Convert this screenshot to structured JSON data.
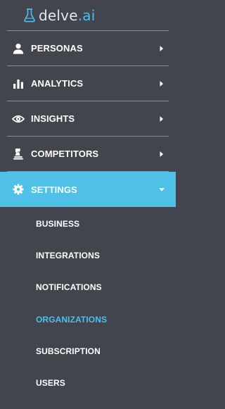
{
  "brand": {
    "name_main": "delve",
    "name_suffix": ".ai",
    "accent_color": "#4fc1e9"
  },
  "nav": {
    "items": [
      {
        "label": "PERSONAS",
        "icon": "user-icon",
        "state": "collapsed"
      },
      {
        "label": "ANALYTICS",
        "icon": "bar-chart-icon",
        "state": "collapsed"
      },
      {
        "label": "INSIGHTS",
        "icon": "eye-icon",
        "state": "collapsed"
      },
      {
        "label": "COMPETITORS",
        "icon": "chess-piece-icon",
        "state": "collapsed"
      },
      {
        "label": "SETTINGS",
        "icon": "gear-icon",
        "state": "expanded"
      }
    ]
  },
  "settings_submenu": {
    "items": [
      {
        "label": "BUSINESS"
      },
      {
        "label": "INTEGRATIONS"
      },
      {
        "label": "NOTIFICATIONS"
      },
      {
        "label": "ORGANIZATIONS",
        "selected": true
      },
      {
        "label": "SUBSCRIPTION"
      },
      {
        "label": "USERS"
      }
    ]
  },
  "colors": {
    "sidebar_background": "#42444e",
    "active_background": "#4fc1e9",
    "selected_text": "#4fc1e9",
    "text": "#ffffff",
    "divider": "#8a8c95"
  }
}
